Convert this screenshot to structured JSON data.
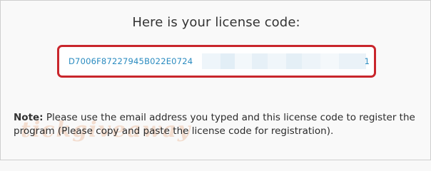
{
  "dialog": {
    "heading": "Here is your license code:",
    "license_code_visible": "D7006F87227945B022E0724",
    "license_code_tail": "1",
    "note_label": "Note:",
    "note_text": " Please use the email address you typed and this license code to register the program (Please copy and paste the license code for registration).",
    "watermark": "tickgiveaway"
  },
  "colors": {
    "highlight_border": "#c9262c",
    "code_text": "#2a8bc0"
  }
}
